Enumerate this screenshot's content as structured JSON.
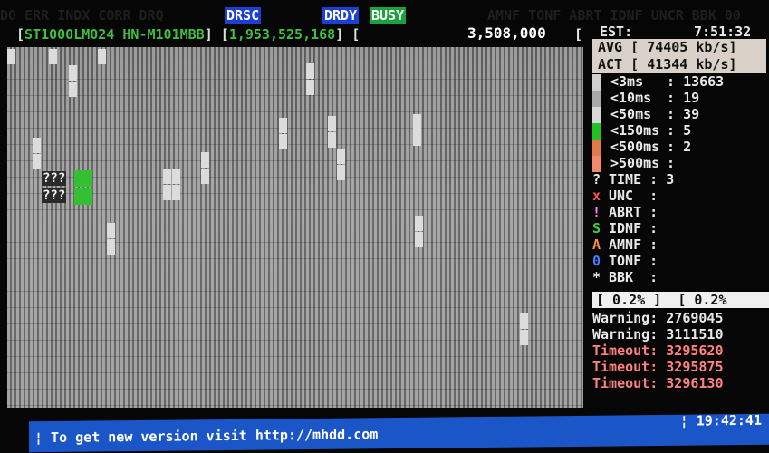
{
  "flags": {
    "dim_left": "DO ERR INDX CORR DRQ",
    "drsc": "DRSC",
    "drdy": "DRDY",
    "busy": "BUSY",
    "dim_right": "AMNF TONF ABRT IDNF UNCR BBK 00",
    "drsc_color": "#1c3fd6",
    "drdy_color": "#1c3fd6",
    "busy_color": "#1aa33a"
  },
  "drive": {
    "model": "ST1000LM024 HN-M101MBB",
    "lba_total": "1,953,525,168",
    "lba_current": "3,508,000",
    "bracket_open": "[",
    "bracket_close": "]"
  },
  "stats": {
    "est_label": "EST:",
    "est_value": "7:51:32",
    "avg_label": "AVG",
    "avg_value": "74405 kb/s",
    "act_label": "ACT",
    "act_value": "41344 kb/s",
    "buckets": [
      {
        "label": "<3ms",
        "value": "13663",
        "color": "#cfcfcf"
      },
      {
        "label": "<10ms",
        "value": "19",
        "color": "#a8a8a8"
      },
      {
        "label": "<50ms",
        "value": "39",
        "color": "#d8d8d8"
      },
      {
        "label": "<150ms",
        "value": "5",
        "color": "#22c022"
      },
      {
        "label": "<500ms",
        "value": "2",
        "color": "#e07a4a"
      },
      {
        "label": ">500ms",
        "value": "",
        "color": "#f08a6a"
      }
    ],
    "errors": [
      {
        "sym": "?",
        "label": "TIME",
        "value": "3",
        "color": "#e8e8e8"
      },
      {
        "sym": "x",
        "label": "UNC",
        "value": "",
        "color": "#ff5050"
      },
      {
        "sym": "!",
        "label": "ABRT",
        "value": "",
        "color": "#ff80ff"
      },
      {
        "sym": "S",
        "label": "IDNF",
        "value": "",
        "color": "#40d040"
      },
      {
        "sym": "A",
        "label": "AMNF",
        "value": "",
        "color": "#ff9040"
      },
      {
        "sym": "0",
        "label": "TONF",
        "value": "",
        "color": "#4080ff"
      },
      {
        "sym": "*",
        "label": "BBK",
        "value": "",
        "color": "#e8e8e8"
      }
    ],
    "progress_left": "[  0.2% ]",
    "progress_right": "[  0.2%",
    "log": [
      {
        "kind": "Warning:",
        "value": "2769045"
      },
      {
        "kind": "Warning:",
        "value": "3111510"
      },
      {
        "kind": "Timeout:",
        "value": "3295620"
      },
      {
        "kind": "Timeout:",
        "value": "3295875"
      },
      {
        "kind": "Timeout:",
        "value": "3296130"
      }
    ]
  },
  "scan": {
    "unknown_marker": "???"
  },
  "footer": {
    "message": "¦ To get new version visit http://mhdd.com",
    "clock": "¦ 19:42:41"
  }
}
